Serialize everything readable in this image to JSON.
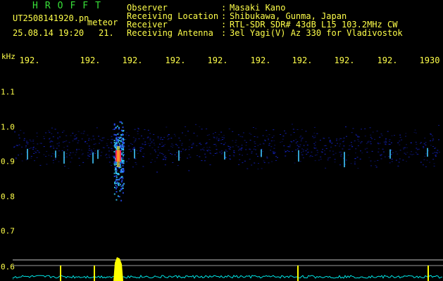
{
  "header": {
    "program": "HROFFT",
    "filename": "UT2508141920.pn",
    "filename_suffix": "meteor",
    "datetime": "25.08.14 19:20",
    "counter": "21."
  },
  "info": [
    {
      "label": "Observer",
      "colon": ":",
      "value": "Masaki Kano"
    },
    {
      "label": "Receiving Location",
      "colon": ":",
      "value": "Shibukawa, Gunma, Japan"
    },
    {
      "label": "Receiver",
      "colon": ":",
      "value": "RTL-SDR SDR# 43dB L15 103.2MHz CW"
    },
    {
      "label": "Receiving Antenna",
      "colon": ":",
      "value": "3el Yagi(V) Az 330 for Vladivostok"
    }
  ],
  "axis": {
    "y_unit": "kHz",
    "x_ticks": [
      "192.",
      "192.",
      "192.",
      "192.",
      "192.",
      "192.",
      "192.",
      "192.",
      "192.",
      "1930"
    ],
    "y_ticks": [
      "1.1",
      "1.0",
      "0.9",
      "0.8",
      "0.7",
      "0.6"
    ]
  },
  "colors": {
    "text": "#ffff4a",
    "title": "#38e038",
    "spectrum_noise": "#1b2dff",
    "echo_core": "#ff2a5a",
    "power_line": "#00e5e5",
    "power_peak": "#ffff00"
  }
}
